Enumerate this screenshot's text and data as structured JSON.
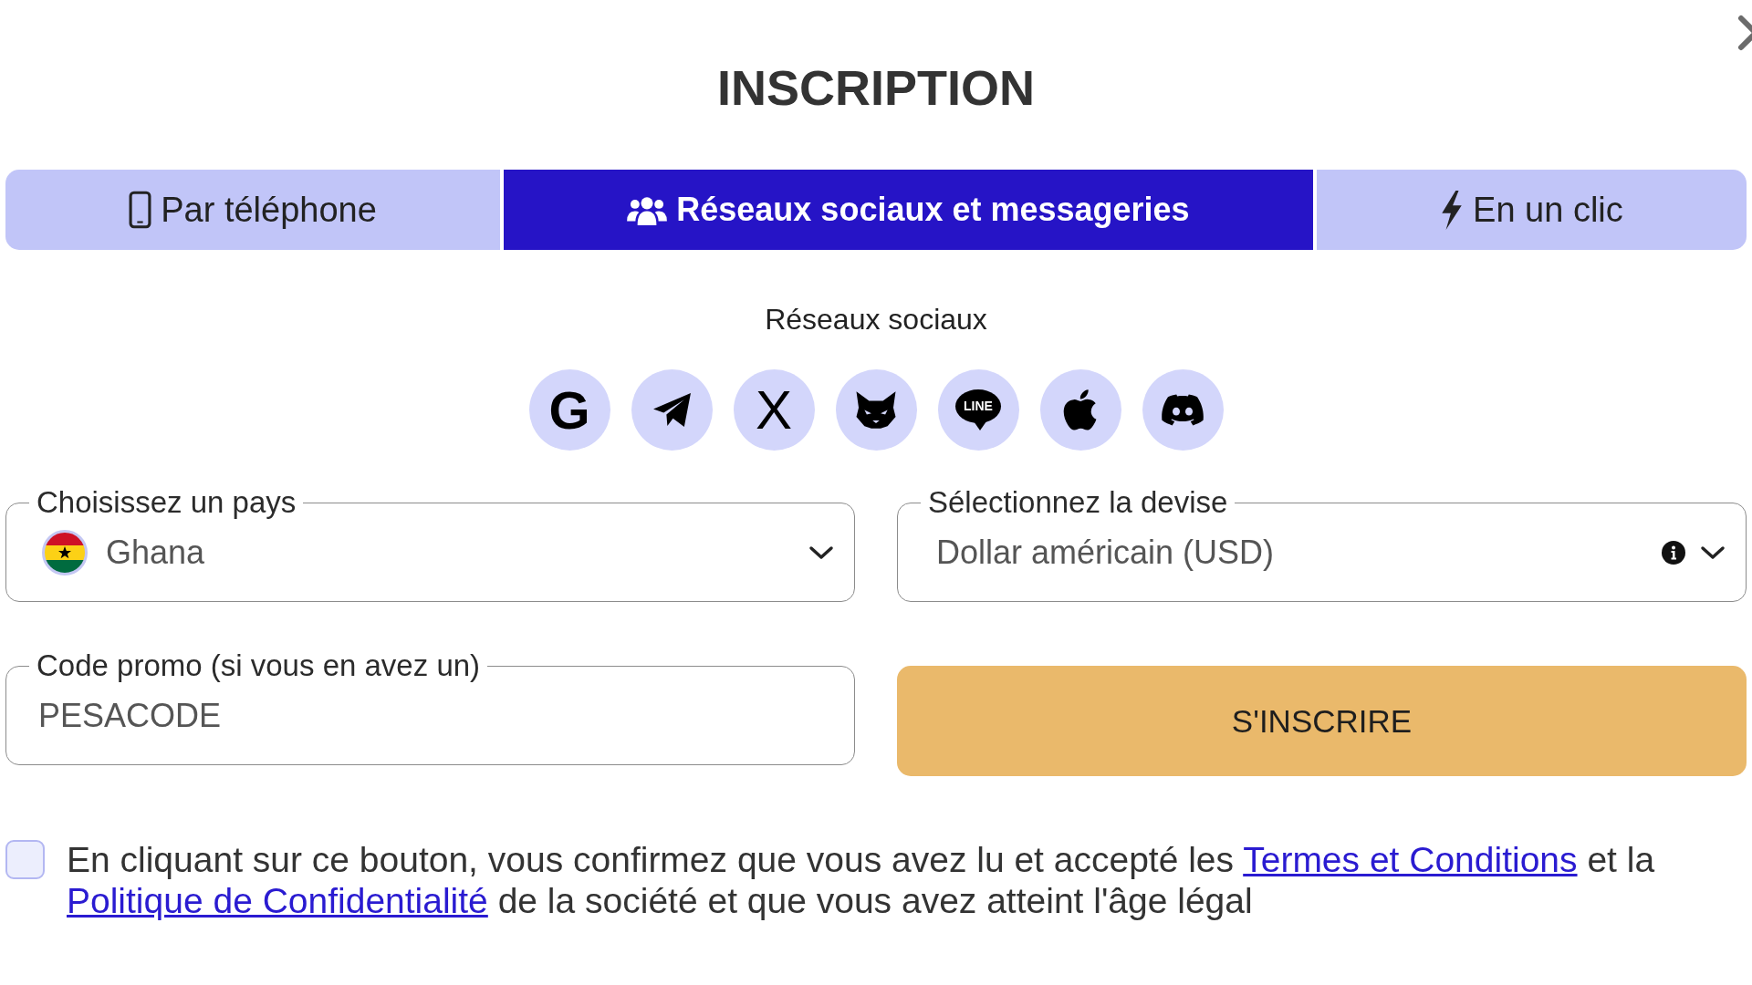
{
  "dialog": {
    "title": "INSCRIPTION"
  },
  "tabs": [
    {
      "label": "Par téléphone",
      "kind": "phone",
      "selected": false
    },
    {
      "label": "Réseaux sociaux et messageries",
      "kind": "group",
      "selected": true
    },
    {
      "label": "En un clic",
      "kind": "instant",
      "selected": false
    }
  ],
  "social": {
    "heading": "Réseaux sociaux",
    "buttons": [
      {
        "kind": "letter",
        "text": "G"
      },
      {
        "kind": "plane"
      },
      {
        "kind": "glyph",
        "text": "X"
      },
      {
        "kind": "fox"
      },
      {
        "kind": "chat",
        "text": "LINE"
      },
      {
        "kind": "apple"
      },
      {
        "kind": "controller"
      }
    ]
  },
  "country": {
    "label": "Choisissez un pays",
    "value": "Ghana"
  },
  "currency": {
    "label": "Sélectionnez la devise",
    "value": "Dollar américain (USD)"
  },
  "promo": {
    "label": "Code promo (si vous en avez un)",
    "value": "PESACODE"
  },
  "submit": {
    "label": "S'INSCRIRE"
  },
  "consent": {
    "checked": false,
    "segments": [
      {
        "kind": "text",
        "text": "En cliquant sur ce bouton, vous confirmez que vous avez lu et accepté les"
      },
      {
        "kind": "link",
        "text": "Termes et Conditions"
      },
      {
        "kind": "text",
        "text": "et la"
      },
      {
        "kind": "link",
        "text": "Politique de Confidentialité"
      },
      {
        "kind": "text",
        "text": "de la société et que vous avez atteint l'âge légal"
      }
    ]
  }
}
